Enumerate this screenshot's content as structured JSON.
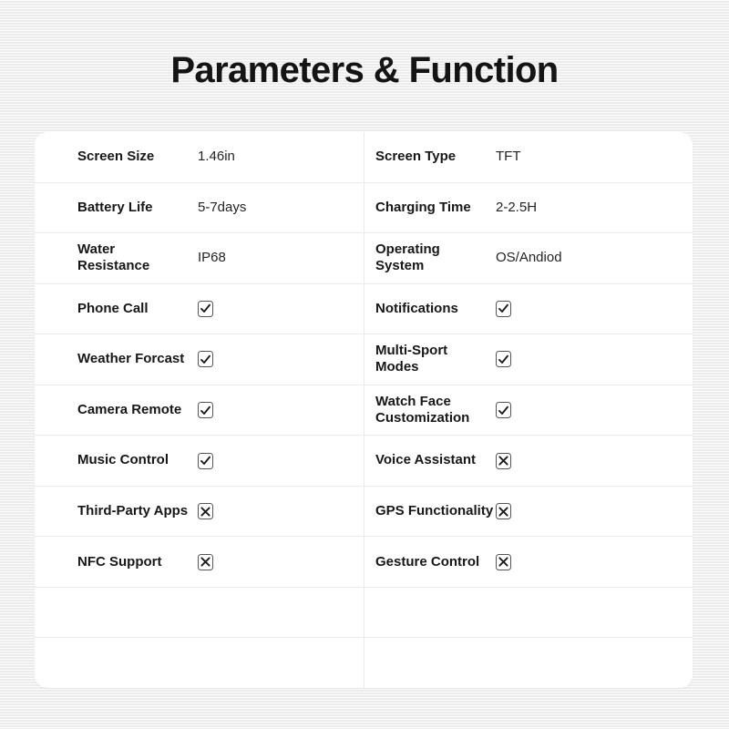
{
  "page": {
    "title": "Parameters & Function",
    "background_color": "#f2f2f2",
    "card_color": "#ffffff",
    "text_color": "#171717",
    "divider_color": "#ebebeb",
    "mark_color": "#555555"
  },
  "table": {
    "columns": 2,
    "rows": [
      {
        "left": {
          "label": "Screen Size",
          "value": "1.46in",
          "type": "text"
        },
        "right": {
          "label": "Screen Type",
          "value": "TFT",
          "type": "text"
        }
      },
      {
        "left": {
          "label": "Battery Life",
          "value": "5-7days",
          "type": "text"
        },
        "right": {
          "label": "Charging Time",
          "value": "2-2.5H",
          "type": "text"
        }
      },
      {
        "left": {
          "label": "Water\nResistance",
          "value": "IP68",
          "type": "text"
        },
        "right": {
          "label": "Operating\nSystem",
          "value": "OS/Andiod",
          "type": "text"
        }
      },
      {
        "left": {
          "label": "Phone Call",
          "value": "",
          "type": "check",
          "icon": "checkbox-checked-icon"
        },
        "right": {
          "label": "Notifications",
          "value": "",
          "type": "check",
          "icon": "checkbox-checked-icon"
        }
      },
      {
        "left": {
          "label": "Weather Forcast",
          "value": "",
          "type": "check",
          "icon": "checkbox-checked-icon"
        },
        "right": {
          "label": "Multi-Sport\nModes",
          "value": "",
          "type": "check",
          "icon": "checkbox-checked-icon"
        }
      },
      {
        "left": {
          "label": "Camera Remote",
          "value": "",
          "type": "check",
          "icon": "checkbox-checked-icon"
        },
        "right": {
          "label": "Watch Face\nCustomization",
          "value": "",
          "type": "check",
          "icon": "checkbox-checked-icon"
        }
      },
      {
        "left": {
          "label": "Music Control",
          "value": "",
          "type": "check",
          "icon": "checkbox-checked-icon"
        },
        "right": {
          "label": "Voice Assistant",
          "value": "",
          "type": "cross",
          "icon": "checkbox-crossed-icon"
        }
      },
      {
        "left": {
          "label": "Third-Party Apps",
          "value": "",
          "type": "cross",
          "icon": "checkbox-crossed-icon"
        },
        "right": {
          "label": "GPS Functionality",
          "value": "",
          "type": "cross",
          "icon": "checkbox-crossed-icon"
        }
      },
      {
        "left": {
          "label": "NFC Support",
          "value": "",
          "type": "cross",
          "icon": "checkbox-crossed-icon"
        },
        "right": {
          "label": "Gesture Control",
          "value": "",
          "type": "cross",
          "icon": "checkbox-crossed-icon"
        }
      },
      {
        "left": {
          "label": "",
          "value": "",
          "type": "empty"
        },
        "right": {
          "label": "",
          "value": "",
          "type": "empty"
        }
      },
      {
        "left": {
          "label": "",
          "value": "",
          "type": "empty"
        },
        "right": {
          "label": "",
          "value": "",
          "type": "empty"
        }
      }
    ]
  }
}
